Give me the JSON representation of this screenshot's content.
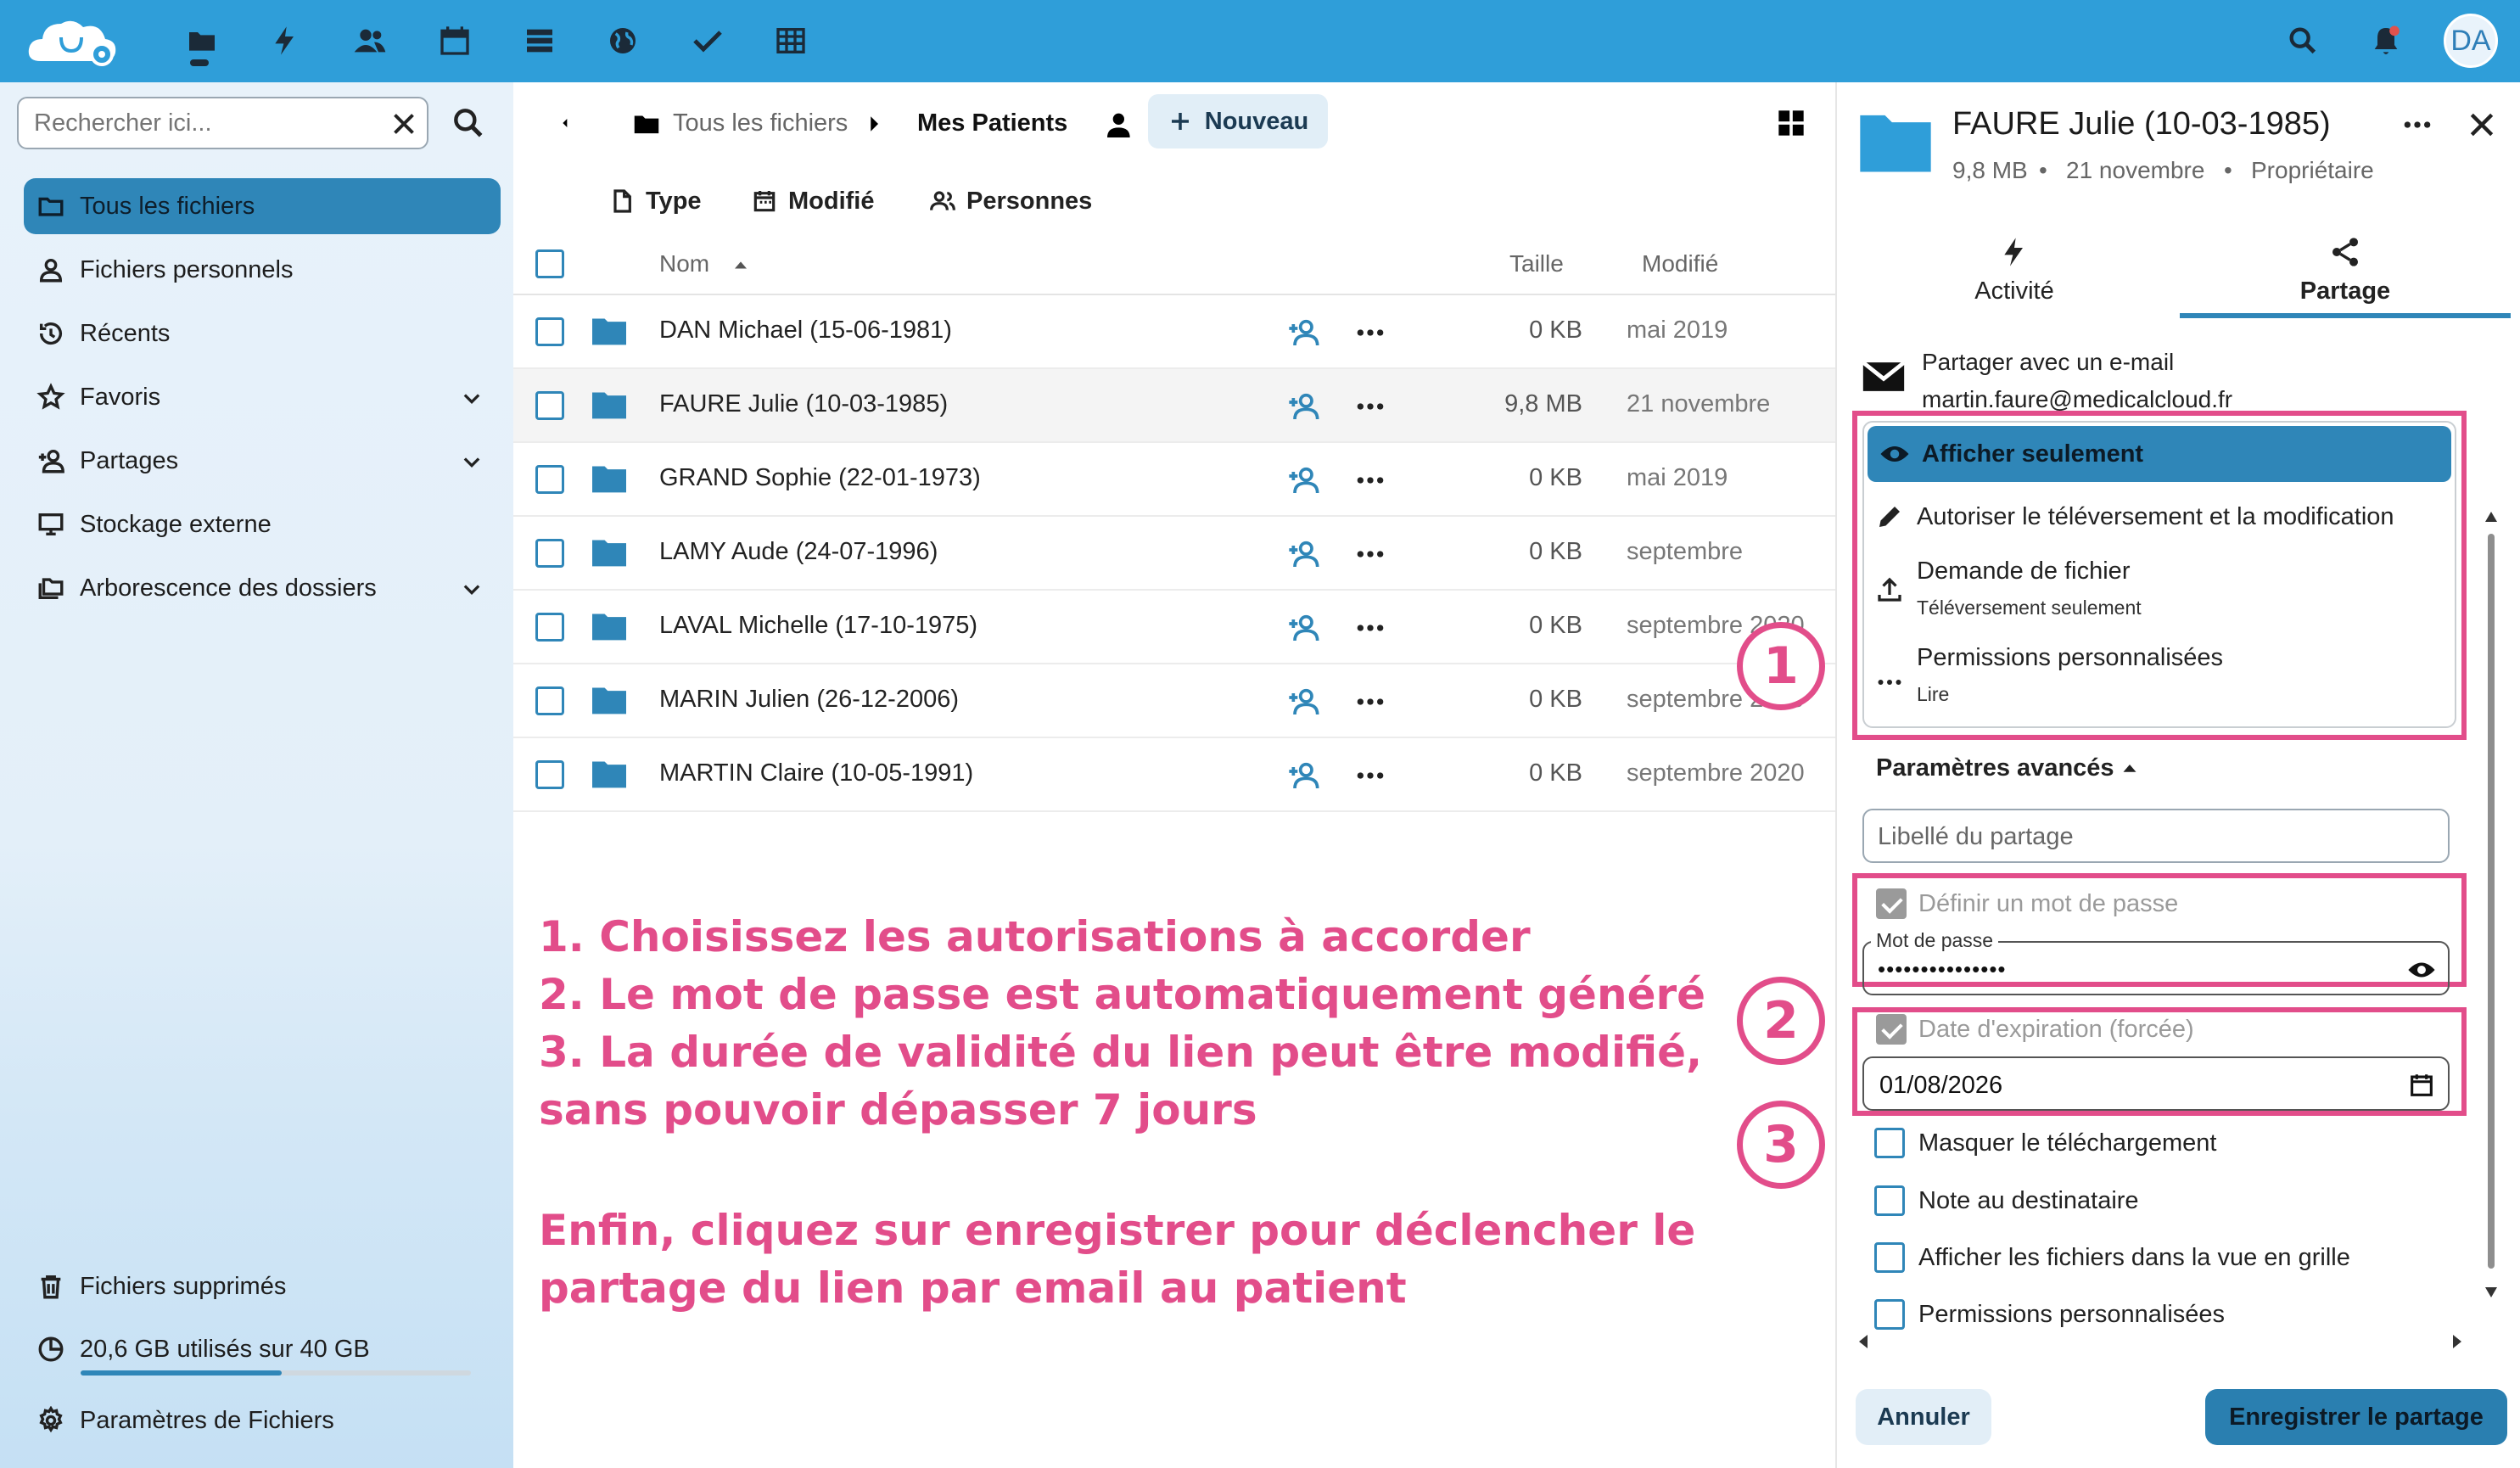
{
  "topbar": {
    "apps": [
      "files-icon",
      "activity-icon",
      "contacts-icon",
      "calendar-icon",
      "deck-icon",
      "web-icon",
      "tasks-icon",
      "tables-icon"
    ],
    "avatar_initials": "DA"
  },
  "sidebar": {
    "search_placeholder": "Rechercher ici...",
    "items": [
      {
        "label": "Tous les fichiers",
        "icon": "folder-icon",
        "active": true
      },
      {
        "label": "Fichiers personnels",
        "icon": "user-icon"
      },
      {
        "label": "Récents",
        "icon": "history-icon"
      },
      {
        "label": "Favoris",
        "icon": "star-icon"
      },
      {
        "label": "Partages",
        "icon": "share-user-icon"
      },
      {
        "label": "Stockage externe",
        "icon": "monitor-icon"
      },
      {
        "label": "Arborescence des dossiers",
        "icon": "folder-tree-icon"
      }
    ],
    "trash_label": "Fichiers supprimés",
    "storage_label": "20,6 GB utilisés sur 40 GB",
    "storage_used_fraction": 0.515,
    "settings_label": "Paramètres de Fichiers"
  },
  "main": {
    "breadcrumb": {
      "root": "Tous les fichiers",
      "current": "Mes Patients"
    },
    "new_button": "Nouveau",
    "filters": {
      "type": "Type",
      "modified": "Modifié",
      "people": "Personnes"
    },
    "columns": {
      "name": "Nom",
      "size": "Taille",
      "modified": "Modifié"
    },
    "rows": [
      {
        "name": "DAN Michael (15-06-1981)",
        "size": "0 KB",
        "modified": "mai 2019"
      },
      {
        "name": "FAURE Julie (10-03-1985)",
        "size": "9,8 MB",
        "modified": "21 novembre"
      },
      {
        "name": "GRAND Sophie (22-01-1973)",
        "size": "0 KB",
        "modified": "mai 2019"
      },
      {
        "name": "LAMY Aude (24-07-1996)",
        "size": "0 KB",
        "modified": "septembre"
      },
      {
        "name": "LAVAL Michelle (17-10-1975)",
        "size": "0 KB",
        "modified": "septembre 2020"
      },
      {
        "name": "MARIN Julien (26-12-2006)",
        "size": "0 KB",
        "modified": "septembre 2020"
      },
      {
        "name": "MARTIN Claire (10-05-1991)",
        "size": "0 KB",
        "modified": "septembre 2020"
      }
    ]
  },
  "annotations": {
    "line1": "1. Choisissez les autorisations à accorder",
    "line2": "2. Le mot de passe est automatiquement généré",
    "line3": "3. La durée de validité du lien peut être modifié,",
    "line4": "sans pouvoir dépasser 7 jours",
    "line5": "Enfin, cliquez sur enregistrer pour déclencher le",
    "line6": "partage du lien par email au patient",
    "markers": [
      "1",
      "2",
      "3"
    ],
    "color": "#e24d8a"
  },
  "panel": {
    "title": "FAURE Julie (10-03-1985)",
    "size": "9,8 MB",
    "date": "21 novembre",
    "owner": "Propriétaire",
    "tabs": [
      {
        "label": "Activité"
      },
      {
        "label": "Partage",
        "active": true
      }
    ],
    "share_email_label": "Partager avec un e-mail",
    "share_email": "martin.faure@medicalcloud.fr",
    "permissions": [
      {
        "label": "Afficher seulement",
        "selected": true
      },
      {
        "label": "Autoriser le téléversement et la modification"
      },
      {
        "label": "Demande de fichier",
        "sub": "Téléversement seulement"
      },
      {
        "label": "Permissions personnalisées",
        "sub": "Lire"
      }
    ],
    "advanced_label": "Paramètres avancés",
    "share_label_placeholder": "Libellé du partage",
    "set_password_label": "Définir un mot de passe",
    "password_field_label": "Mot de passe",
    "password_value": "•••••••••••••••",
    "expiry_label": "Date d'expiration (forcée)",
    "expiry_value": "01/08/2026",
    "options": [
      "Masquer le téléchargement",
      "Note au destinataire",
      "Afficher les fichiers dans la vue en grille",
      "Permissions personnalisées"
    ],
    "cancel_label": "Annuler",
    "save_label": "Enregistrer le partage"
  }
}
